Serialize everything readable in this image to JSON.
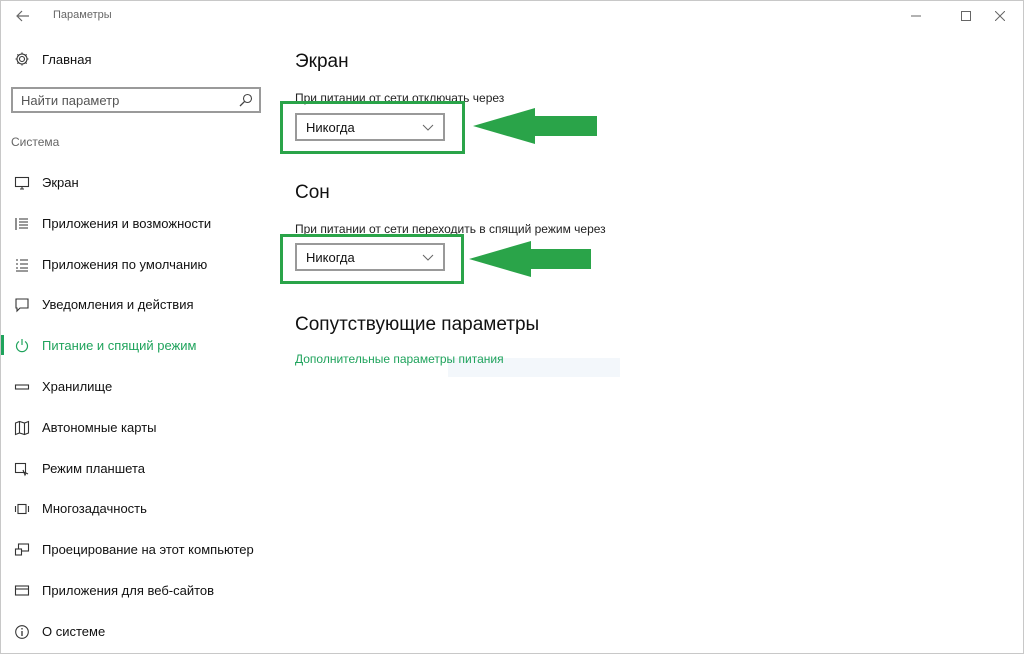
{
  "window": {
    "title": "Параметры"
  },
  "sidebar": {
    "home_label": "Главная",
    "search_placeholder": "Найти параметр",
    "section_header": "Система",
    "items": [
      {
        "label": "Экран",
        "icon": "display-icon",
        "active": false
      },
      {
        "label": "Приложения и возможности",
        "icon": "apps-list-icon",
        "active": false
      },
      {
        "label": "Приложения по умолчанию",
        "icon": "default-apps-icon",
        "active": false
      },
      {
        "label": "Уведомления и действия",
        "icon": "notifications-icon",
        "active": false
      },
      {
        "label": "Питание и спящий режим",
        "icon": "power-icon",
        "active": true
      },
      {
        "label": "Хранилище",
        "icon": "storage-icon",
        "active": false
      },
      {
        "label": "Автономные карты",
        "icon": "map-icon",
        "active": false
      },
      {
        "label": "Режим планшета",
        "icon": "tablet-icon",
        "active": false
      },
      {
        "label": "Многозадачность",
        "icon": "multitasking-icon",
        "active": false
      },
      {
        "label": "Проецирование на этот компьютер",
        "icon": "projecting-icon",
        "active": false
      },
      {
        "label": "Приложения для веб-сайтов",
        "icon": "web-apps-icon",
        "active": false
      },
      {
        "label": "О системе",
        "icon": "info-icon",
        "active": false
      }
    ]
  },
  "main": {
    "screen": {
      "heading": "Экран",
      "label": "При питании от сети отключать через",
      "value": "Никогда"
    },
    "sleep": {
      "heading": "Сон",
      "label": "При питании от сети переходить в спящий режим через",
      "value": "Никогда"
    },
    "related": {
      "heading": "Сопутствующие параметры",
      "link": "Дополнительные параметры питания"
    }
  },
  "colors": {
    "accent": "#1fa35c",
    "annotation": "#2aa449"
  }
}
